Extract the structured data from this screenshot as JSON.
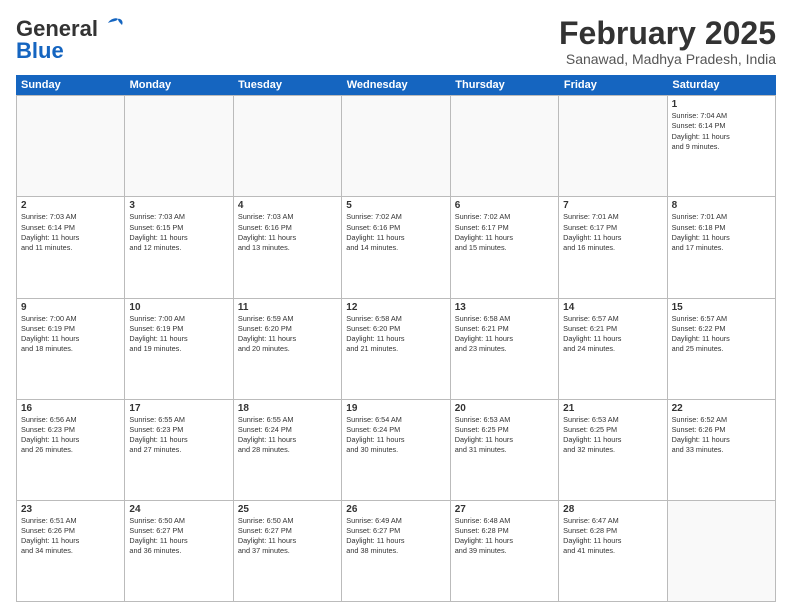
{
  "logo": {
    "line1": "General",
    "line2": "Blue"
  },
  "header": {
    "month": "February 2025",
    "location": "Sanawad, Madhya Pradesh, India"
  },
  "weekdays": [
    "Sunday",
    "Monday",
    "Tuesday",
    "Wednesday",
    "Thursday",
    "Friday",
    "Saturday"
  ],
  "weeks": [
    [
      {
        "day": "",
        "info": ""
      },
      {
        "day": "",
        "info": ""
      },
      {
        "day": "",
        "info": ""
      },
      {
        "day": "",
        "info": ""
      },
      {
        "day": "",
        "info": ""
      },
      {
        "day": "",
        "info": ""
      },
      {
        "day": "1",
        "info": "Sunrise: 7:04 AM\nSunset: 6:14 PM\nDaylight: 11 hours\nand 9 minutes."
      }
    ],
    [
      {
        "day": "2",
        "info": "Sunrise: 7:03 AM\nSunset: 6:14 PM\nDaylight: 11 hours\nand 11 minutes."
      },
      {
        "day": "3",
        "info": "Sunrise: 7:03 AM\nSunset: 6:15 PM\nDaylight: 11 hours\nand 12 minutes."
      },
      {
        "day": "4",
        "info": "Sunrise: 7:03 AM\nSunset: 6:16 PM\nDaylight: 11 hours\nand 13 minutes."
      },
      {
        "day": "5",
        "info": "Sunrise: 7:02 AM\nSunset: 6:16 PM\nDaylight: 11 hours\nand 14 minutes."
      },
      {
        "day": "6",
        "info": "Sunrise: 7:02 AM\nSunset: 6:17 PM\nDaylight: 11 hours\nand 15 minutes."
      },
      {
        "day": "7",
        "info": "Sunrise: 7:01 AM\nSunset: 6:17 PM\nDaylight: 11 hours\nand 16 minutes."
      },
      {
        "day": "8",
        "info": "Sunrise: 7:01 AM\nSunset: 6:18 PM\nDaylight: 11 hours\nand 17 minutes."
      }
    ],
    [
      {
        "day": "9",
        "info": "Sunrise: 7:00 AM\nSunset: 6:19 PM\nDaylight: 11 hours\nand 18 minutes."
      },
      {
        "day": "10",
        "info": "Sunrise: 7:00 AM\nSunset: 6:19 PM\nDaylight: 11 hours\nand 19 minutes."
      },
      {
        "day": "11",
        "info": "Sunrise: 6:59 AM\nSunset: 6:20 PM\nDaylight: 11 hours\nand 20 minutes."
      },
      {
        "day": "12",
        "info": "Sunrise: 6:58 AM\nSunset: 6:20 PM\nDaylight: 11 hours\nand 21 minutes."
      },
      {
        "day": "13",
        "info": "Sunrise: 6:58 AM\nSunset: 6:21 PM\nDaylight: 11 hours\nand 23 minutes."
      },
      {
        "day": "14",
        "info": "Sunrise: 6:57 AM\nSunset: 6:21 PM\nDaylight: 11 hours\nand 24 minutes."
      },
      {
        "day": "15",
        "info": "Sunrise: 6:57 AM\nSunset: 6:22 PM\nDaylight: 11 hours\nand 25 minutes."
      }
    ],
    [
      {
        "day": "16",
        "info": "Sunrise: 6:56 AM\nSunset: 6:23 PM\nDaylight: 11 hours\nand 26 minutes."
      },
      {
        "day": "17",
        "info": "Sunrise: 6:55 AM\nSunset: 6:23 PM\nDaylight: 11 hours\nand 27 minutes."
      },
      {
        "day": "18",
        "info": "Sunrise: 6:55 AM\nSunset: 6:24 PM\nDaylight: 11 hours\nand 28 minutes."
      },
      {
        "day": "19",
        "info": "Sunrise: 6:54 AM\nSunset: 6:24 PM\nDaylight: 11 hours\nand 30 minutes."
      },
      {
        "day": "20",
        "info": "Sunrise: 6:53 AM\nSunset: 6:25 PM\nDaylight: 11 hours\nand 31 minutes."
      },
      {
        "day": "21",
        "info": "Sunrise: 6:53 AM\nSunset: 6:25 PM\nDaylight: 11 hours\nand 32 minutes."
      },
      {
        "day": "22",
        "info": "Sunrise: 6:52 AM\nSunset: 6:26 PM\nDaylight: 11 hours\nand 33 minutes."
      }
    ],
    [
      {
        "day": "23",
        "info": "Sunrise: 6:51 AM\nSunset: 6:26 PM\nDaylight: 11 hours\nand 34 minutes."
      },
      {
        "day": "24",
        "info": "Sunrise: 6:50 AM\nSunset: 6:27 PM\nDaylight: 11 hours\nand 36 minutes."
      },
      {
        "day": "25",
        "info": "Sunrise: 6:50 AM\nSunset: 6:27 PM\nDaylight: 11 hours\nand 37 minutes."
      },
      {
        "day": "26",
        "info": "Sunrise: 6:49 AM\nSunset: 6:27 PM\nDaylight: 11 hours\nand 38 minutes."
      },
      {
        "day": "27",
        "info": "Sunrise: 6:48 AM\nSunset: 6:28 PM\nDaylight: 11 hours\nand 39 minutes."
      },
      {
        "day": "28",
        "info": "Sunrise: 6:47 AM\nSunset: 6:28 PM\nDaylight: 11 hours\nand 41 minutes."
      },
      {
        "day": "",
        "info": ""
      }
    ]
  ]
}
